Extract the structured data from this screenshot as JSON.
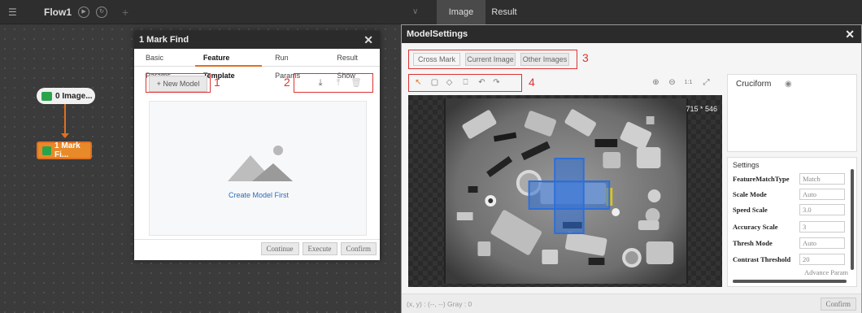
{
  "flow": {
    "title": "Flow1"
  },
  "nodes": {
    "image": "0 Image...",
    "mark": "1 Mark Fi..."
  },
  "markfind": {
    "title": "1 Mark Find",
    "tabs": [
      "Basic Params",
      "Feature Template",
      "Run Params",
      "Result Show"
    ],
    "active_tab": "Feature Template",
    "new_model": "+ New Model",
    "create_first": "Create Model First",
    "buttons": {
      "continue": "Continue",
      "execute": "Execute",
      "confirm": "Confirm"
    },
    "annotations": {
      "one": "1",
      "two": "2"
    }
  },
  "right_tabs": {
    "image": "Image",
    "result": "Result"
  },
  "modelsettings": {
    "title": "ModelSettings",
    "sources": {
      "cross": "Cross Mark",
      "current": "Current Image",
      "other": "Other Images"
    },
    "annotations": {
      "three": "3",
      "four": "4"
    },
    "image_size": "715 * 546",
    "shape_name": "Cruciform",
    "settings_title": "Settings",
    "settings": [
      {
        "label": "FeatureMatchType",
        "value": "Match"
      },
      {
        "label": "Scale Mode",
        "value": "Auto"
      },
      {
        "label": "Speed Scale",
        "value": "3.0"
      },
      {
        "label": "Accuracy Scale",
        "value": "3"
      },
      {
        "label": "Thresh Mode",
        "value": "Auto"
      },
      {
        "label": "Contrast Threshold",
        "value": "20"
      }
    ],
    "advance": "Advance Param",
    "coords": "(x, y) : (--, --) Gray : 0",
    "confirm": "Confirm"
  },
  "colors": {
    "accent": "#e07020",
    "annotation": "#dd3333",
    "roi": "#2d6fd9"
  }
}
